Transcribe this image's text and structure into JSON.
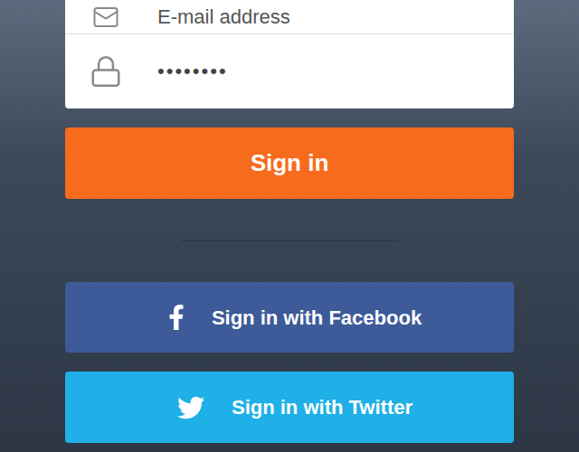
{
  "form": {
    "fields": [
      {
        "kind": "email",
        "placeholder": "E-mail address",
        "value": ""
      },
      {
        "kind": "password",
        "placeholder": "",
        "value": "••••••••"
      }
    ]
  },
  "sign_in_button": "Sign in",
  "social_buttons": [
    {
      "label": "Sign in with Facebook",
      "network": "facebook",
      "color": "#3d5a99"
    },
    {
      "label": "Sign in with Twitter",
      "network": "twitter",
      "color": "#1eb0e6"
    }
  ]
}
